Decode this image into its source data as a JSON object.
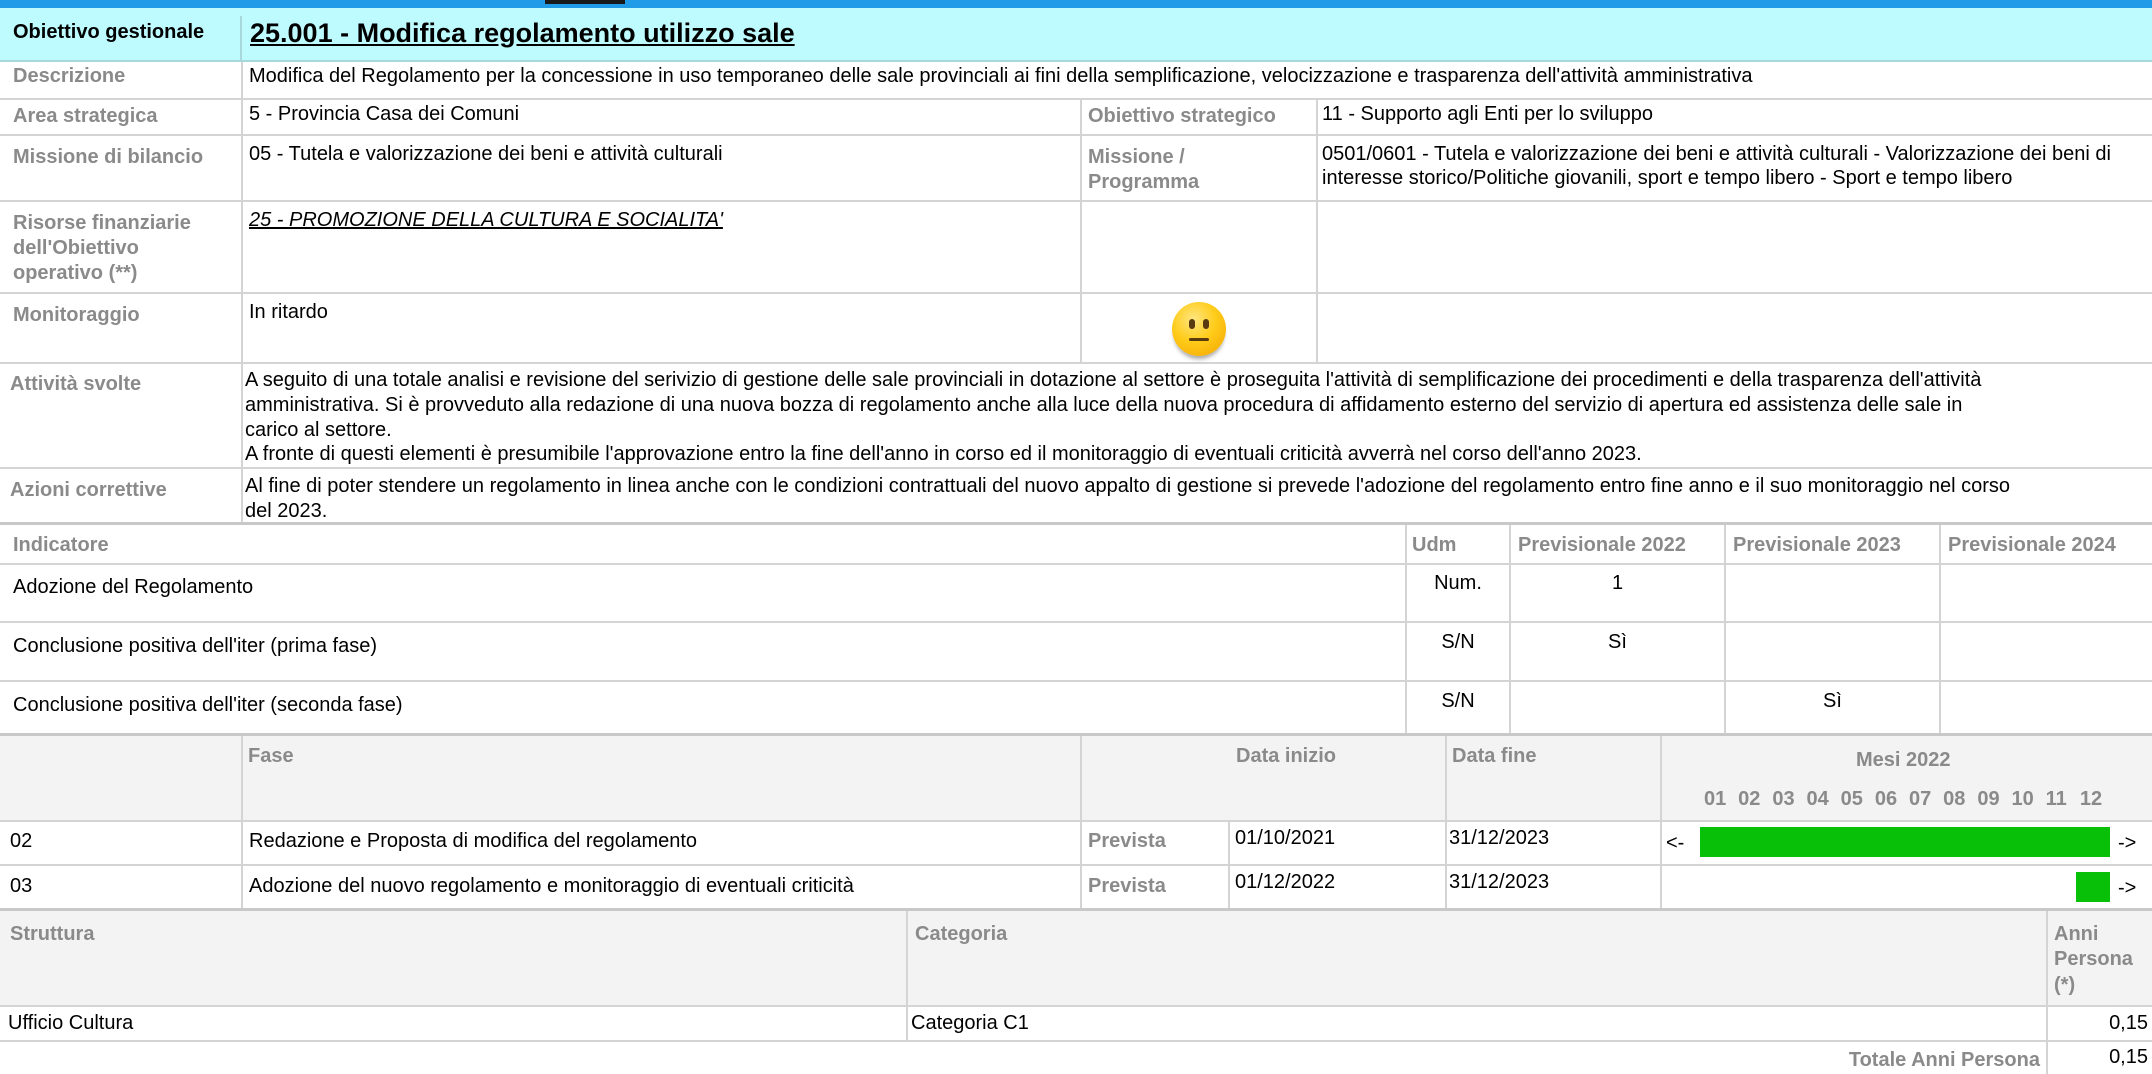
{
  "header": {
    "label": "Obiettivo gestionale",
    "title": "25.001 - Modifica regolamento utilizzo sale"
  },
  "descrizione": {
    "label": "Descrizione",
    "value": "Modifica del Regolamento per la concessione in uso temporaneo delle sale provinciali ai fini della semplificazione, velocizzazione e trasparenza dell'attività amministrativa"
  },
  "area_strategica": {
    "label": "Area strategica",
    "value": "5 - Provincia Casa dei Comuni"
  },
  "obiettivo_strategico": {
    "label": "Obiettivo strategico",
    "value": "11 - Supporto agli Enti per lo sviluppo"
  },
  "missione_bilancio": {
    "label": "Missione di bilancio",
    "value": "05 - Tutela e valorizzazione dei beni e attività culturali"
  },
  "missione_programma": {
    "label_line1": "Missione /",
    "label_line2": "Programma",
    "value": "0501/0601 - Tutela e valorizzazione dei beni e attività culturali - Valorizzazione dei beni di interesse storico/Politiche giovanili, sport e tempo libero - Sport e tempo libero"
  },
  "risorse": {
    "label_line1": "Risorse finanziarie",
    "label_line2": "dell'Obiettivo",
    "label_line3": "operativo (**)",
    "value": "25 - PROMOZIONE DELLA CULTURA E SOCIALITA'"
  },
  "monitoraggio": {
    "label": "Monitoraggio",
    "value": "In ritardo",
    "icon": "neutral-face-icon"
  },
  "attivita": {
    "label": "Attività svolte",
    "line1": "A seguito di una totale analisi e revisione del serivizio di gestione delle sale provinciali in dotazione al settore è proseguita l'attività di semplificazione dei procedimenti e della trasparenza dell'attività",
    "line2": "amministrativa. Si è provveduto alla redazione di una nuova bozza di regolamento anche alla luce della nuova procedura  di affidamento esterno del servizio di apertura ed assistenza delle sale in",
    "line3": "carico al settore.",
    "line4": "A fronte di questi elementi è presumibile l'approvazione entro la fine dell'anno in corso ed il monitoraggio di eventuali criticità avverrà nel corso dell'anno 2023."
  },
  "azioni": {
    "label": "Azioni correttive",
    "line1": "Al fine di poter stendere un regolamento in linea anche con le condizioni contrattuali del nuovo appalto di gestione si prevede l'adozione del regolamento entro fine anno e il suo monitoraggio nel corso",
    "line2": "del 2023."
  },
  "indicatori": {
    "headers": {
      "indicatore": "Indicatore",
      "udm": "Udm",
      "p2022": "Previsionale 2022",
      "p2023": "Previsionale 2023",
      "p2024": "Previsionale 2024"
    },
    "rows": [
      {
        "name": "Adozione del Regolamento",
        "udm": "Num.",
        "p2022": "1",
        "p2023": "",
        "p2024": ""
      },
      {
        "name": "Conclusione positiva dell'iter (prima fase)",
        "udm": "S/N",
        "p2022": "Sì",
        "p2023": "",
        "p2024": ""
      },
      {
        "name": "Conclusione positiva dell'iter (seconda fase)",
        "udm": "S/N",
        "p2022": "",
        "p2023": "Sì",
        "p2024": ""
      }
    ]
  },
  "fasi": {
    "headers": {
      "fase": "Fase",
      "data_inizio": "Data inizio",
      "data_fine": "Data fine",
      "mesi": "Mesi 2022"
    },
    "months": [
      "01",
      "02",
      "03",
      "04",
      "05",
      "06",
      "07",
      "08",
      "09",
      "10",
      "11",
      "12"
    ],
    "rows": [
      {
        "code": "02",
        "name": "Redazione e Proposta di modifica del regolamento",
        "tipo": "Prevista",
        "inizio": "01/10/2021",
        "fine": "31/12/2023",
        "left_arrow": "<-",
        "right_arrow": "->",
        "bar_start_month": 1,
        "bar_end_month": 12
      },
      {
        "code": "03",
        "name": "Adozione del nuovo regolamento e monitoraggio di eventuali criticità",
        "tipo": "Prevista",
        "inizio": "01/12/2022",
        "fine": "31/12/2023",
        "left_arrow": "",
        "right_arrow": "->",
        "bar_start_month": 12,
        "bar_end_month": 12
      }
    ],
    "bar_color": "#08c008"
  },
  "risorse_umane": {
    "headers": {
      "struttura": "Struttura",
      "categoria": "Categoria",
      "anni_line1": "Anni",
      "anni_line2": "Persona",
      "anni_line3": "(*)"
    },
    "rows": [
      {
        "struttura": "Ufficio Cultura",
        "categoria": "Categoria C1",
        "anni": "0,15"
      }
    ],
    "totale_label": "Totale Anni Persona",
    "totale": "0,15"
  }
}
